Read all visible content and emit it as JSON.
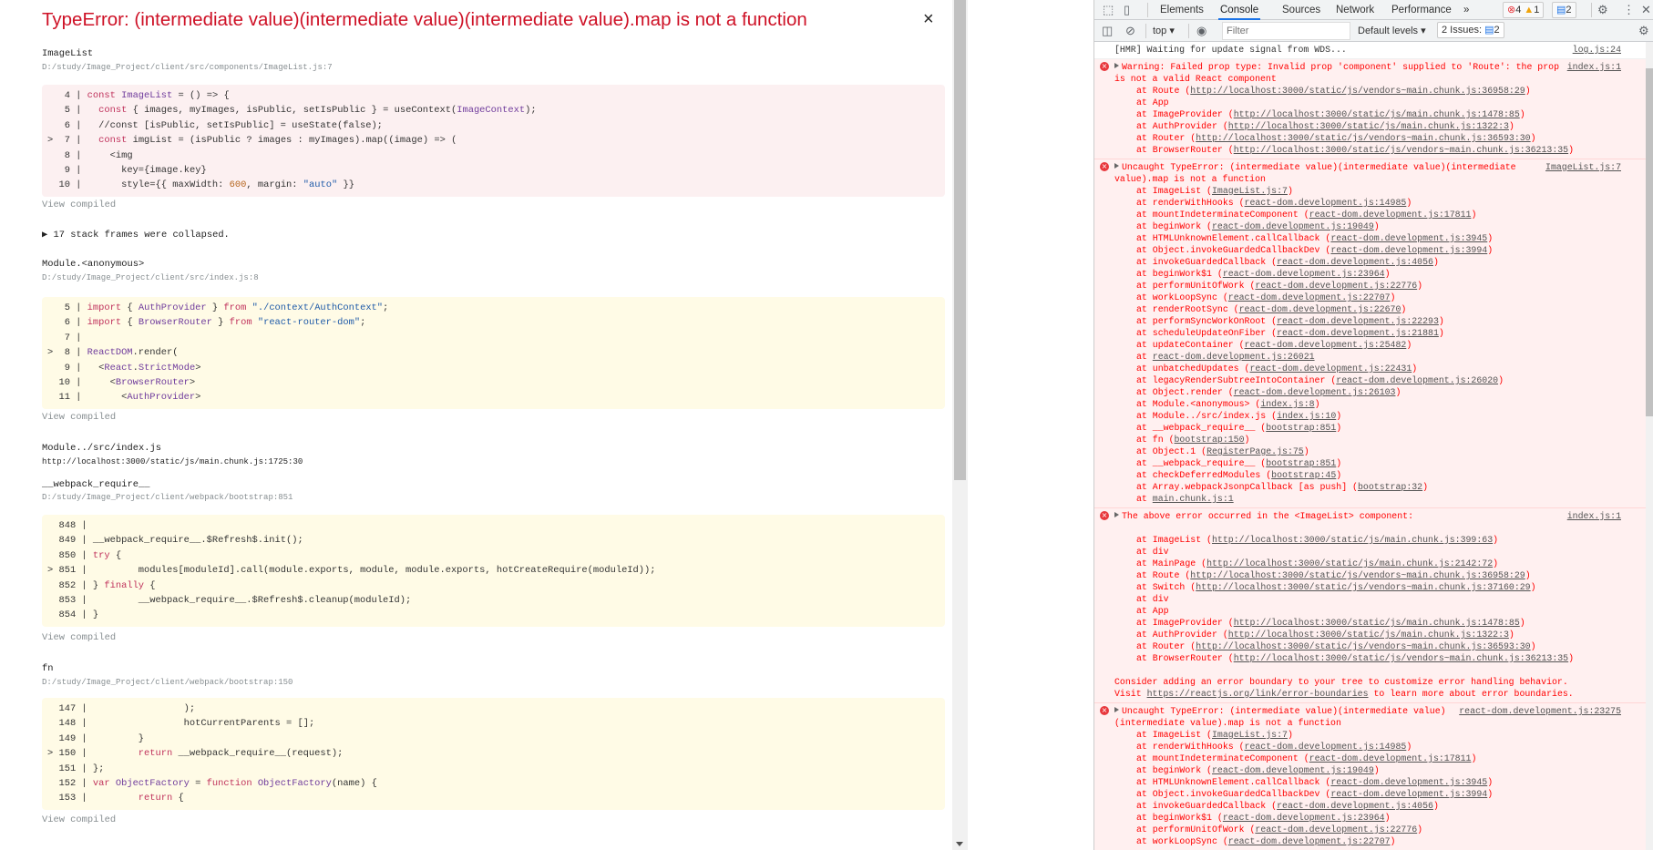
{
  "overlay": {
    "title": "TypeError: (intermediate value)(intermediate value)(intermediate value).map is not a function",
    "close": "×",
    "collapsed": "17 stack frames were collapsed.",
    "view_compiled": "View compiled",
    "frames": [
      {
        "name": "ImageList",
        "path": "D:/study/Image_Project/client/src/components/ImageList.js:7",
        "color": "red",
        "code": [
          {
            "n": 4,
            "t": "const ImageList = () => {"
          },
          {
            "n": 5,
            "t": "  const { images, myImages, isPublic, setIsPublic } = useContext(ImageContext);"
          },
          {
            "n": 6,
            "t": "  //const [isPublic, setIsPublic] = useState(false);"
          },
          {
            "n": 7,
            "t": "  const imgList = (isPublic ? images : myImages).map((image) => (",
            "hl": true
          },
          {
            "n": 8,
            "t": "    <img"
          },
          {
            "n": 9,
            "t": "      key={image.key}"
          },
          {
            "n": 10,
            "t": "      style={{ maxWidth: 600, margin: \"auto\" }}"
          }
        ]
      },
      {
        "name": "Module.<anonymous>",
        "path": "D:/study/Image_Project/client/src/index.js:8",
        "color": "yel",
        "code": [
          {
            "n": 5,
            "t": "import { AuthProvider } from \"./context/AuthContext\";"
          },
          {
            "n": 6,
            "t": "import { BrowserRouter } from \"react-router-dom\";"
          },
          {
            "n": 7,
            "t": ""
          },
          {
            "n": 8,
            "t": "ReactDOM.render(",
            "hl": true
          },
          {
            "n": 9,
            "t": "  <React.StrictMode>"
          },
          {
            "n": 10,
            "t": "    <BrowserRouter>"
          },
          {
            "n": 11,
            "t": "      <AuthProvider>"
          }
        ]
      },
      {
        "name": "Module../src/index.js",
        "path": "http://localhost:3000/static/js/main.chunk.js:1725:30"
      },
      {
        "name": "__webpack_require__",
        "path": "D:/study/Image_Project/client/webpack/bootstrap:851",
        "color": "yel",
        "code": [
          {
            "n": 848,
            "t": ""
          },
          {
            "n": 849,
            "t": "__webpack_require__.$Refresh$.init();"
          },
          {
            "n": 850,
            "t": "try {"
          },
          {
            "n": 851,
            "t": "        modules[moduleId].call(module.exports, module, module.exports, hotCreateRequire(moduleId));",
            "hl": true
          },
          {
            "n": 852,
            "t": "} finally {"
          },
          {
            "n": 853,
            "t": "        __webpack_require__.$Refresh$.cleanup(moduleId);"
          },
          {
            "n": 854,
            "t": "}"
          }
        ]
      },
      {
        "name": "fn",
        "path": "D:/study/Image_Project/client/webpack/bootstrap:150",
        "color": "yel",
        "code": [
          {
            "n": 147,
            "t": "                );"
          },
          {
            "n": 148,
            "t": "                hotCurrentParents = [];"
          },
          {
            "n": 149,
            "t": "        }"
          },
          {
            "n": 150,
            "t": "        return __webpack_require__(request);",
            "hl": true
          },
          {
            "n": 151,
            "t": "};"
          },
          {
            "n": 152,
            "t": "var ObjectFactory = function ObjectFactory(name) {"
          },
          {
            "n": 153,
            "t": "        return {"
          }
        ]
      }
    ]
  },
  "devtools": {
    "tabs": [
      "Elements",
      "Console",
      "Sources",
      "Network",
      "Performance"
    ],
    "active_tab": "Console",
    "more": "»",
    "error_count": "4",
    "warning_count": "1",
    "message_count": "2",
    "context": "top",
    "filter_placeholder": "Filter",
    "levels": "Default levels",
    "issues_label": "2 Issues:",
    "issues_count": "2",
    "colors": {
      "accent": "#1a73e8",
      "error": "#ff0000",
      "error_bg": "#fff0f0"
    }
  },
  "console": [
    {
      "type": "log",
      "lines": [
        "[HMR] Waiting for update signal from WDS..."
      ],
      "src": "log.js:24"
    },
    {
      "type": "err",
      "lines": [
        "Warning: Failed prop type: Invalid prop 'component' supplied to 'Route': the prop",
        "is not a valid React component"
      ],
      "src": "index.js:1",
      "frames": [
        [
          "Route",
          "http://localhost:3000/static/js/vendors~main.chunk.js:36958:29"
        ],
        [
          "App",
          ""
        ],
        [
          "ImageProvider",
          "http://localhost:3000/static/js/main.chunk.js:1478:85"
        ],
        [
          "AuthProvider",
          "http://localhost:3000/static/js/main.chunk.js:1322:3"
        ],
        [
          "Router",
          "http://localhost:3000/static/js/vendors~main.chunk.js:36593:30"
        ],
        [
          "BrowserRouter",
          "http://localhost:3000/static/js/vendors~main.chunk.js:36213:35"
        ]
      ]
    },
    {
      "type": "err",
      "lines": [
        "Uncaught TypeError: (intermediate value)(intermediate value)(intermediate",
        "value).map is not a function"
      ],
      "src": "ImageList.js:7",
      "frames": [
        [
          "ImageList",
          "ImageList.js:7"
        ],
        [
          "renderWithHooks",
          "react-dom.development.js:14985"
        ],
        [
          "mountIndeterminateComponent",
          "react-dom.development.js:17811"
        ],
        [
          "beginWork",
          "react-dom.development.js:19049"
        ],
        [
          "HTMLUnknownElement.callCallback",
          "react-dom.development.js:3945"
        ],
        [
          "Object.invokeGuardedCallbackDev",
          "react-dom.development.js:3994"
        ],
        [
          "invokeGuardedCallback",
          "react-dom.development.js:4056"
        ],
        [
          "beginWork$1",
          "react-dom.development.js:23964"
        ],
        [
          "performUnitOfWork",
          "react-dom.development.js:22776"
        ],
        [
          "workLoopSync",
          "react-dom.development.js:22707"
        ],
        [
          "renderRootSync",
          "react-dom.development.js:22670"
        ],
        [
          "performSyncWorkOnRoot",
          "react-dom.development.js:22293"
        ],
        [
          "scheduleUpdateOnFiber",
          "react-dom.development.js:21881"
        ],
        [
          "updateContainer",
          "react-dom.development.js:25482"
        ],
        [
          "",
          "react-dom.development.js:26021"
        ],
        [
          "unbatchedUpdates",
          "react-dom.development.js:22431"
        ],
        [
          "legacyRenderSubtreeIntoContainer",
          "react-dom.development.js:26020"
        ],
        [
          "Object.render",
          "react-dom.development.js:26103"
        ],
        [
          "Module.<anonymous>",
          "index.js:8"
        ],
        [
          "Module../src/index.js",
          "index.js:10"
        ],
        [
          "__webpack_require__",
          "bootstrap:851"
        ],
        [
          "fn",
          "bootstrap:150"
        ],
        [
          "Object.1",
          "RegisterPage.js:75"
        ],
        [
          "__webpack_require__",
          "bootstrap:851"
        ],
        [
          "checkDeferredModules",
          "bootstrap:45"
        ],
        [
          "Array.webpackJsonpCallback [as push]",
          "bootstrap:32"
        ],
        [
          "",
          "main.chunk.js:1"
        ]
      ]
    },
    {
      "type": "err",
      "lines": [
        "The above error occurred in the <ImageList> component:",
        ""
      ],
      "src": "index.js:1",
      "frames": [
        [
          "ImageList",
          "http://localhost:3000/static/js/main.chunk.js:399:63"
        ],
        [
          "div",
          ""
        ],
        [
          "MainPage",
          "http://localhost:3000/static/js/main.chunk.js:2142:72"
        ],
        [
          "Route",
          "http://localhost:3000/static/js/vendors~main.chunk.js:36958:29"
        ],
        [
          "Switch",
          "http://localhost:3000/static/js/vendors~main.chunk.js:37160:29"
        ],
        [
          "div",
          ""
        ],
        [
          "App",
          ""
        ],
        [
          "ImageProvider",
          "http://localhost:3000/static/js/main.chunk.js:1478:85"
        ],
        [
          "AuthProvider",
          "http://localhost:3000/static/js/main.chunk.js:1322:3"
        ],
        [
          "Router",
          "http://localhost:3000/static/js/vendors~main.chunk.js:36593:30"
        ],
        [
          "BrowserRouter",
          "http://localhost:3000/static/js/vendors~main.chunk.js:36213:35"
        ]
      ],
      "footer": [
        "",
        "Consider adding an error boundary to your tree to customize error handling behavior."
      ],
      "visit": {
        "pre": "Visit ",
        "link": "https://reactjs.org/link/error-boundaries",
        "post": " to learn more about error boundaries."
      }
    },
    {
      "type": "err",
      "lines": [
        "Uncaught TypeError: (intermediate value)(intermediate value)",
        "(intermediate value).map is not a function"
      ],
      "src": "react-dom.development.js:23275",
      "frames": [
        [
          "ImageList",
          "ImageList.js:7"
        ],
        [
          "renderWithHooks",
          "react-dom.development.js:14985"
        ],
        [
          "mountIndeterminateComponent",
          "react-dom.development.js:17811"
        ],
        [
          "beginWork",
          "react-dom.development.js:19049"
        ],
        [
          "HTMLUnknownElement.callCallback",
          "react-dom.development.js:3945"
        ],
        [
          "Object.invokeGuardedCallbackDev",
          "react-dom.development.js:3994"
        ],
        [
          "invokeGuardedCallback",
          "react-dom.development.js:4056"
        ],
        [
          "beginWork$1",
          "react-dom.development.js:23964"
        ],
        [
          "performUnitOfWork",
          "react-dom.development.js:22776"
        ],
        [
          "workLoopSync",
          "react-dom.development.js:22707"
        ]
      ]
    }
  ]
}
